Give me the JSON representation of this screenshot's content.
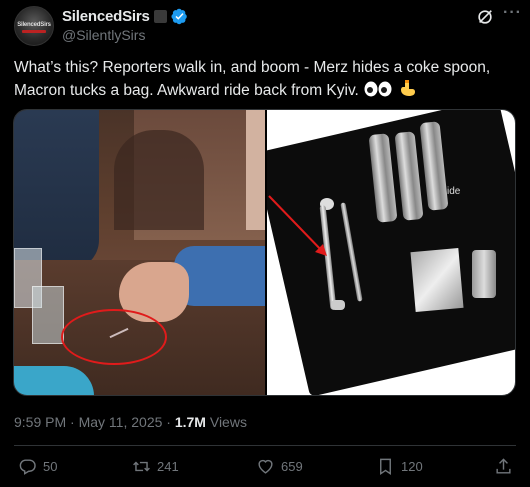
{
  "author": {
    "display_name": "SilencedSirs",
    "handle": "@SilentlySirs",
    "avatar_text": "SilencedSirs",
    "verified": true
  },
  "tweet": {
    "text_line1": "What’s this? Reporters walk in, and boom - Merz hides a coke spoon,",
    "text_line2": "Macron tucks a bag. Awkward ride back from Kyiv.",
    "emojis": [
      "eyes-emoji",
      "pointing-down-emoji"
    ]
  },
  "media": {
    "right_image_label": "ide"
  },
  "meta": {
    "time": "9:59 PM",
    "separator": "·",
    "date": "May 11, 2025",
    "views_count": "1.7M",
    "views_label": "Views"
  },
  "actions": {
    "replies": "50",
    "reposts": "241",
    "likes": "659",
    "bookmarks": "120"
  },
  "colors": {
    "background": "#000000",
    "text": "#e7e9ea",
    "muted": "#71767b",
    "verified": "#1d9bf0",
    "border": "#2f3336",
    "highlight_red": "#e01b1b"
  }
}
